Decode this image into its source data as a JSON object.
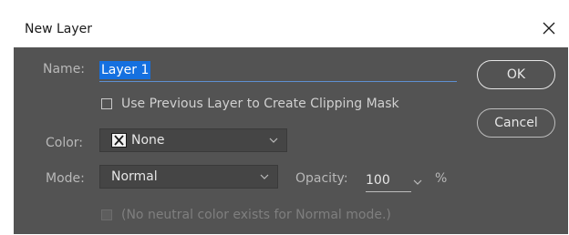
{
  "dialog": {
    "title": "New Layer",
    "close_icon": "close-icon"
  },
  "name": {
    "label": "Name:",
    "value": "Layer 1"
  },
  "clipping_mask": {
    "label": "Use Previous Layer to Create Clipping Mask",
    "checked": false
  },
  "color": {
    "label": "Color:",
    "value": "None",
    "icon": "no-color-x-icon"
  },
  "mode": {
    "label": "Mode:",
    "value": "Normal"
  },
  "opacity": {
    "label": "Opacity:",
    "value": "100",
    "unit": "%"
  },
  "neutral": {
    "label": "(No neutral color exists for Normal mode.)",
    "enabled": false
  },
  "buttons": {
    "ok": "OK",
    "cancel": "Cancel"
  },
  "colors": {
    "panel": "#535353",
    "selection": "#1570e0"
  }
}
